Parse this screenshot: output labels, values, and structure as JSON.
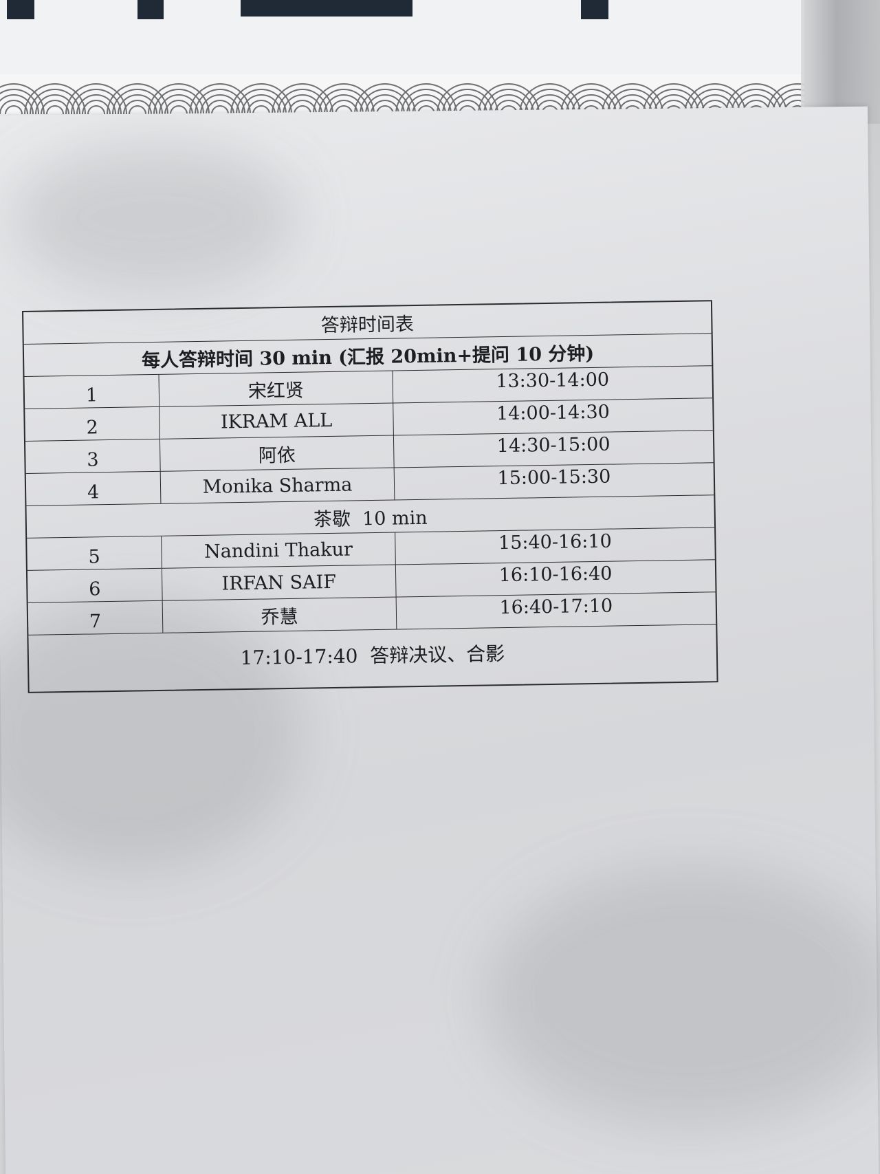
{
  "schedule": {
    "title": "答辩时间表",
    "subtitle": "每人答辩时间 30 min (汇报 20min+提问 10 分钟)",
    "rows_first": [
      {
        "num": "1",
        "name": "宋红贤",
        "time": "13:30-14:00"
      },
      {
        "num": "2",
        "name": "IKRAM ALL",
        "time": "14:00-14:30"
      },
      {
        "num": "3",
        "name": "阿依",
        "time": "14:30-15:00"
      },
      {
        "num": "4",
        "name": "Monika Sharma",
        "time": "15:00-15:30"
      }
    ],
    "break_label": "茶歇  10 min",
    "rows_second": [
      {
        "num": "5",
        "name": "Nandini Thakur",
        "time": "15:40-16:10"
      },
      {
        "num": "6",
        "name": "IRFAN SAIF",
        "time": "16:10-16:40"
      },
      {
        "num": "7",
        "name": "乔慧",
        "time": "16:40-17:10"
      }
    ],
    "closing": "17:10-17:40  答辩决议、合影"
  }
}
